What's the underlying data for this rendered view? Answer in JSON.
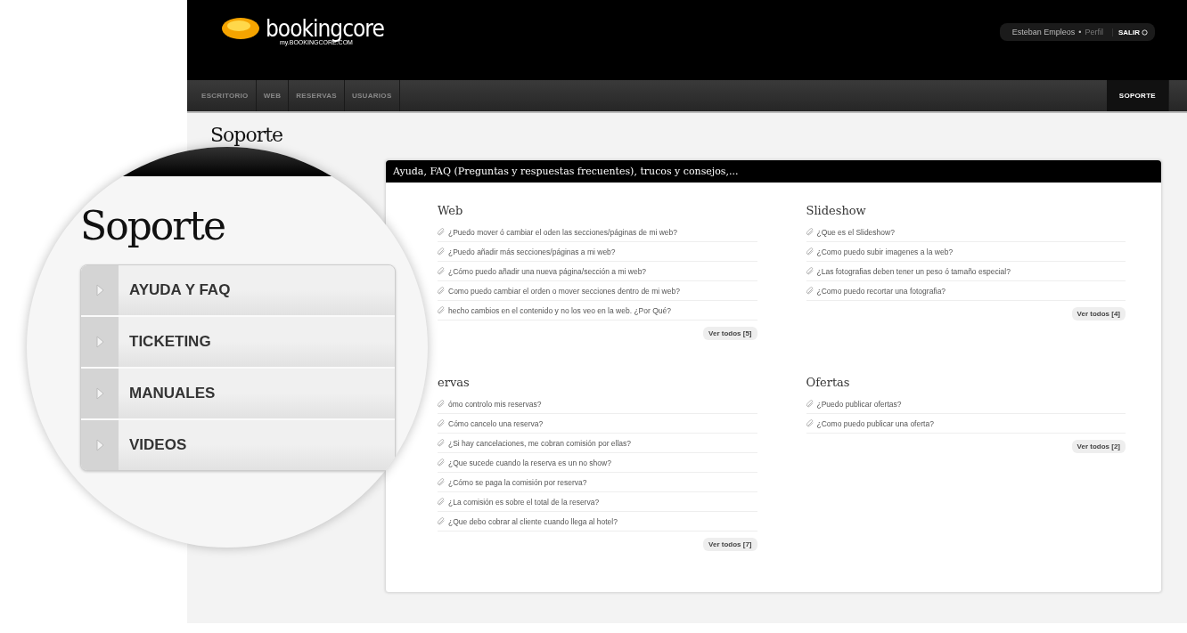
{
  "header": {
    "logo": {
      "name": "bookingcore",
      "url": "my.BOOKINGCORE.COM"
    },
    "user": {
      "name": "Esteban Empleos",
      "separator": "•",
      "profile_link": "Perfil",
      "logout": "SALIR"
    }
  },
  "nav": {
    "tabs": [
      {
        "label": "ESCRITORIO",
        "selected": false
      },
      {
        "label": "WEB",
        "selected": false
      },
      {
        "label": "RESERVAS",
        "selected": false
      },
      {
        "label": "USUARIOS",
        "selected": false
      }
    ],
    "right_tabs": [
      {
        "label": "SOPORTE",
        "selected": true
      }
    ]
  },
  "page_title": "Soporte",
  "panel": {
    "title": "Ayuda, FAQ (Preguntas y respuestas frecuentes), trucos y consejos,...",
    "sections": [
      {
        "heading": "Web",
        "questions": [
          "¿Puedo mover ó cambiar el oden las secciones/páginas de mi web?",
          "¿Puedo añadir más secciones/páginas a mi web?",
          "¿Cómo puedo añadir una nueva página/sección a mi web?",
          "Como puedo cambiar el orden o mover secciones dentro de mi web?",
          "hecho cambios en el contenido y no los veo en la web. ¿Por Qué?"
        ],
        "more": "Ver todos [5]"
      },
      {
        "heading": "Slideshow",
        "questions": [
          "¿Que es el Slideshow?",
          "¿Como puedo subir imagenes a la web?",
          "¿Las fotografias deben tener un peso ó tamaño especial?",
          "¿Como puedo recortar una fotografia?"
        ],
        "more": "Ver todos [4]"
      },
      {
        "heading": "ervas",
        "questions": [
          "ómo controlo mis reservas?",
          "Cómo cancelo una reserva?",
          "¿Si hay cancelaciones, me cobran comisión por ellas?",
          "¿Que sucede cuando la reserva es un no show?",
          "¿Cómo se paga la comisión por reserva?",
          "¿La comisión es sobre el total de la reserva?",
          "¿Que debo cobrar al cliente cuando llega al hotel?"
        ],
        "more": "Ver todos [7]"
      },
      {
        "heading": "Ofertas",
        "questions": [
          "¿Puedo publicar ofertas?",
          "¿Como puedo publicar una oferta?"
        ],
        "more": "Ver todos [2]"
      }
    ]
  },
  "magnifier": {
    "title": "Soporte",
    "menu": [
      {
        "label": "AYUDA Y FAQ"
      },
      {
        "label": "TICKETING"
      },
      {
        "label": "MANUALES"
      },
      {
        "label": "VIDEOS"
      }
    ]
  }
}
